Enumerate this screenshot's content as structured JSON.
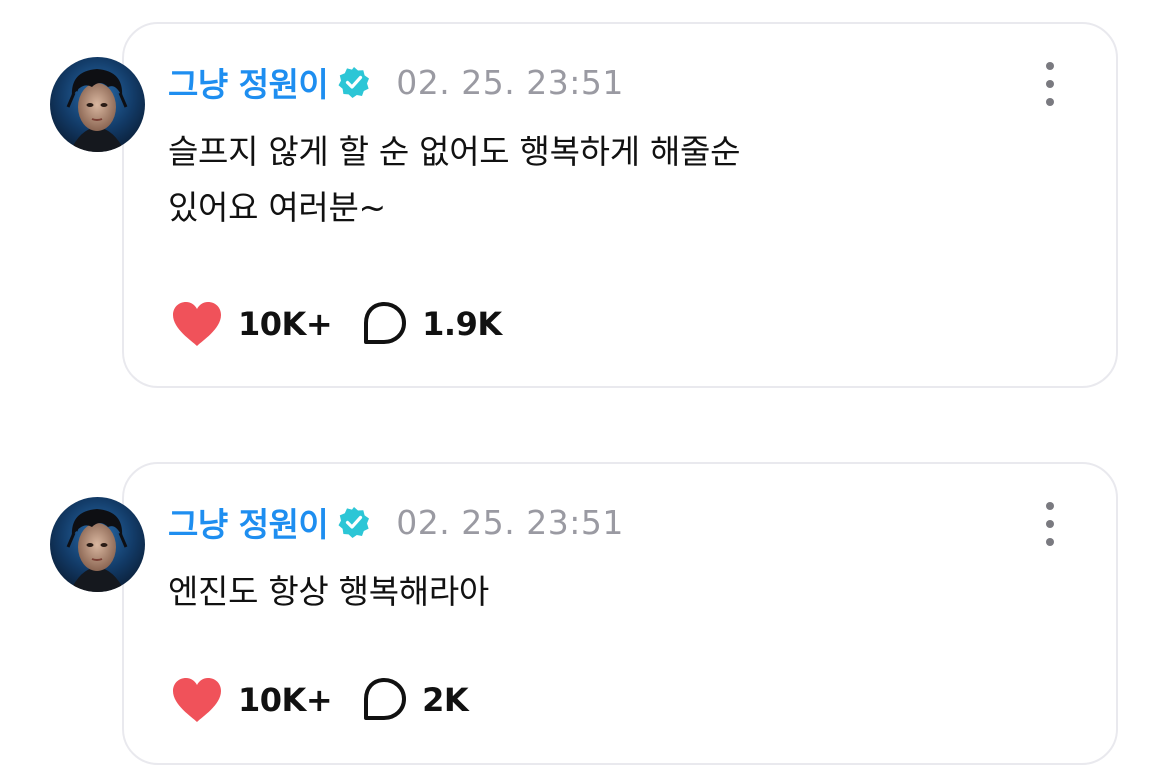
{
  "posts": [
    {
      "author": "그냥 정원이",
      "timestamp": "02. 25. 23:51",
      "lines": [
        "슬프지 않게 할 순 없어도 행복하게 해줄순",
        "있어요 여러분~"
      ],
      "likes": "10K+",
      "comments": "1.9K"
    },
    {
      "author": "그냥 정원이",
      "timestamp": "02. 25. 23:51",
      "lines": [
        "엔진도 항상 행복해라아"
      ],
      "likes": "10K+",
      "comments": "2K"
    }
  ],
  "icons": {
    "verified": "verified-badge-icon",
    "like": "heart-icon",
    "comment": "speech-bubble-icon",
    "more": "more-vertical-icon"
  },
  "colors": {
    "author": "#1e8ef0",
    "verified": "#2cc6d6",
    "heart": "#f0525a",
    "timestamp": "#9a9aa2",
    "card_border": "#e9e9ee"
  }
}
